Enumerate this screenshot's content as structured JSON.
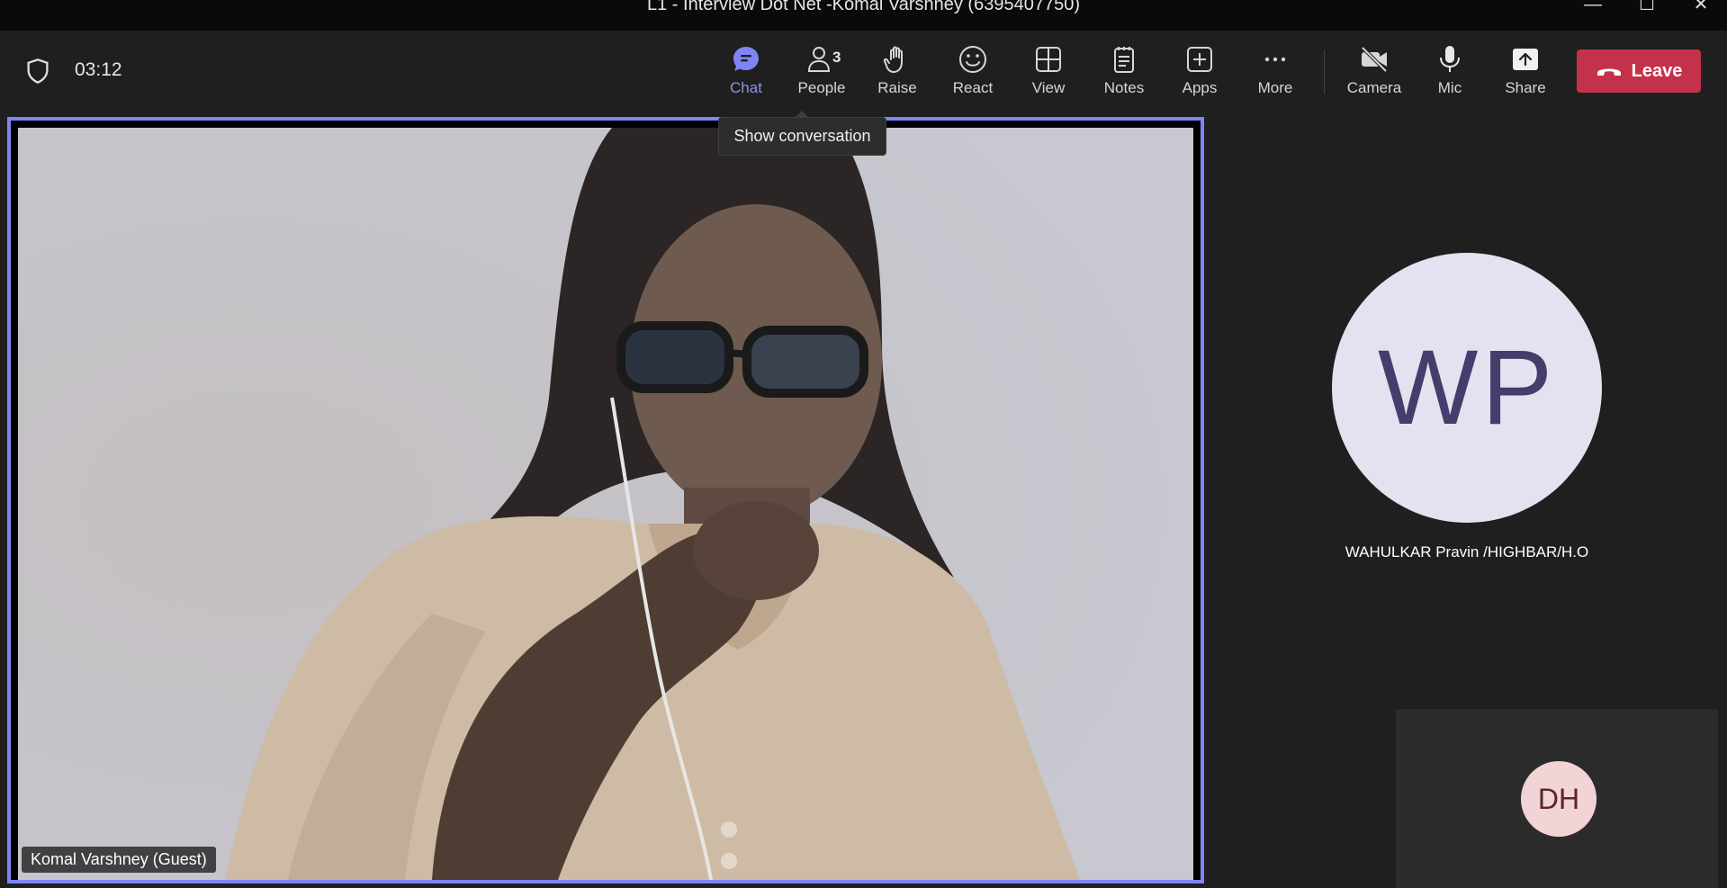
{
  "window": {
    "title": "L1 - Interview Dot Net -Komal Varshney (6395407750)",
    "minimize": "—",
    "maximize": "☐",
    "close": "✕"
  },
  "toolbar": {
    "timer": "03:12",
    "buttons": [
      {
        "id": "chat",
        "label": "Chat",
        "icon": "chat-icon",
        "active": true
      },
      {
        "id": "people",
        "label": "People",
        "icon": "people-icon",
        "badge": "3"
      },
      {
        "id": "raise",
        "label": "Raise",
        "icon": "hand-icon"
      },
      {
        "id": "react",
        "label": "React",
        "icon": "smile-icon"
      },
      {
        "id": "view",
        "label": "View",
        "icon": "grid-icon"
      },
      {
        "id": "notes",
        "label": "Notes",
        "icon": "notes-icon"
      },
      {
        "id": "apps",
        "label": "Apps",
        "icon": "plus-box-icon"
      },
      {
        "id": "more",
        "label": "More",
        "icon": "ellipsis-icon"
      },
      {
        "id": "camera",
        "label": "Camera",
        "icon": "camera-off-icon"
      },
      {
        "id": "mic",
        "label": "Mic",
        "icon": "mic-icon"
      },
      {
        "id": "share",
        "label": "Share",
        "icon": "share-icon"
      }
    ],
    "leave_label": "Leave"
  },
  "tooltip": {
    "text": "Show conversation"
  },
  "stage": {
    "main_participant": {
      "name": "Komal Varshney (Guest)"
    },
    "side_participant": {
      "initials": "WP",
      "name": "WAHULKAR Pravin /HIGHBAR/H.O"
    },
    "thumbnail": {
      "initials": "DH"
    }
  },
  "colors": {
    "accent": "#7f85f5",
    "leave": "#c4314b",
    "active_label": "#8b8fe8"
  }
}
